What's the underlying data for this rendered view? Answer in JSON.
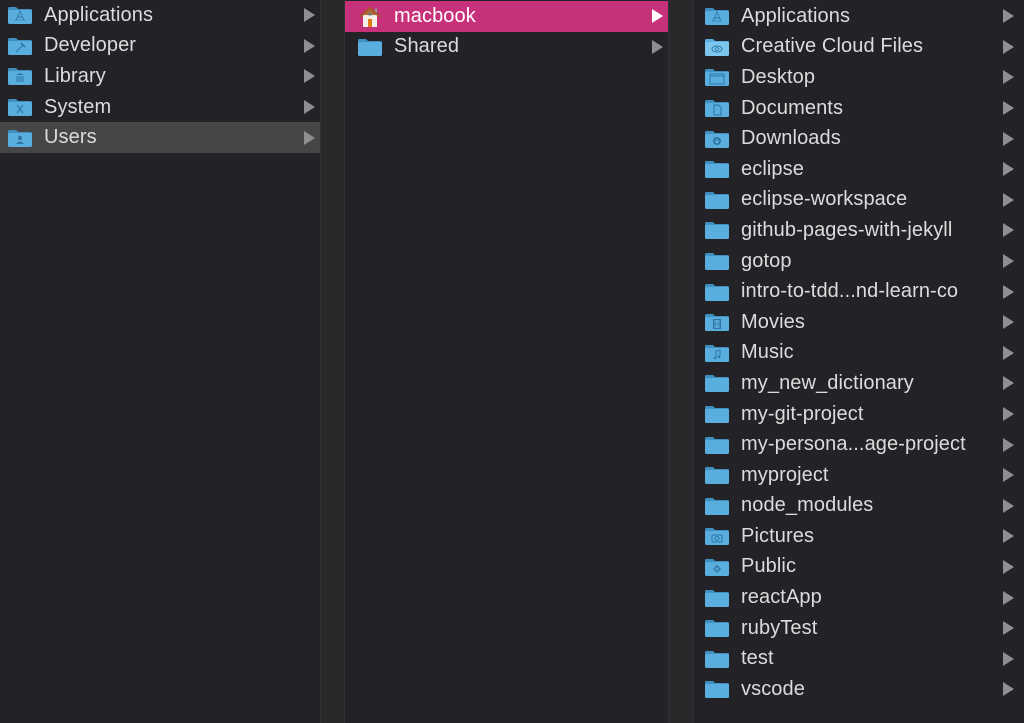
{
  "colors": {
    "folder_blue": "#5aaedd",
    "folder_light": "#74c1ea",
    "selection_active": "#c7317a",
    "selection_inactive": "#464646"
  },
  "columns": [
    {
      "items": [
        {
          "label": "Applications",
          "icon": "applications-folder-icon",
          "glyph": "A"
        },
        {
          "label": "Developer",
          "icon": "developer-folder-icon",
          "glyph": "hammer"
        },
        {
          "label": "Library",
          "icon": "library-folder-icon",
          "glyph": "columns"
        },
        {
          "label": "System",
          "icon": "system-folder-icon",
          "glyph": "X"
        },
        {
          "label": "Users",
          "icon": "users-folder-icon",
          "glyph": "person",
          "selected": "inactive"
        }
      ]
    },
    {
      "items": [
        {
          "label": "macbook",
          "icon": "home-icon",
          "glyph": "home",
          "selected": "active"
        },
        {
          "label": "Shared",
          "icon": "folder-icon",
          "glyph": ""
        }
      ]
    },
    {
      "items": [
        {
          "label": "Applications",
          "icon": "applications-folder-icon",
          "glyph": "A"
        },
        {
          "label": "Creative Cloud Files",
          "icon": "creative-cloud-folder-icon",
          "glyph": "cloud"
        },
        {
          "label": "Desktop",
          "icon": "desktop-folder-icon",
          "glyph": "window"
        },
        {
          "label": "Documents",
          "icon": "documents-folder-icon",
          "glyph": "doc"
        },
        {
          "label": "Downloads",
          "icon": "downloads-folder-icon",
          "glyph": "download"
        },
        {
          "label": "eclipse",
          "icon": "folder-icon",
          "glyph": ""
        },
        {
          "label": "eclipse-workspace",
          "icon": "folder-icon",
          "glyph": ""
        },
        {
          "label": "github-pages-with-jekyll",
          "icon": "folder-icon",
          "glyph": ""
        },
        {
          "label": "gotop",
          "icon": "folder-icon",
          "glyph": ""
        },
        {
          "label": "intro-to-tdd...nd-learn-co",
          "icon": "folder-icon",
          "glyph": ""
        },
        {
          "label": "Movies",
          "icon": "movies-folder-icon",
          "glyph": "film"
        },
        {
          "label": "Music",
          "icon": "music-folder-icon",
          "glyph": "note"
        },
        {
          "label": "my_new_dictionary",
          "icon": "folder-icon",
          "glyph": ""
        },
        {
          "label": "my-git-project",
          "icon": "folder-icon",
          "glyph": ""
        },
        {
          "label": "my-persona...age-project",
          "icon": "folder-icon",
          "glyph": ""
        },
        {
          "label": "myproject",
          "icon": "folder-icon",
          "glyph": ""
        },
        {
          "label": "node_modules",
          "icon": "folder-icon",
          "glyph": ""
        },
        {
          "label": "Pictures",
          "icon": "pictures-folder-icon",
          "glyph": "camera"
        },
        {
          "label": "Public",
          "icon": "public-folder-icon",
          "glyph": "diamond"
        },
        {
          "label": "reactApp",
          "icon": "folder-icon",
          "glyph": ""
        },
        {
          "label": "rubyTest",
          "icon": "folder-icon",
          "glyph": ""
        },
        {
          "label": "test",
          "icon": "folder-icon",
          "glyph": ""
        },
        {
          "label": "vscode",
          "icon": "folder-icon",
          "glyph": ""
        }
      ]
    }
  ]
}
